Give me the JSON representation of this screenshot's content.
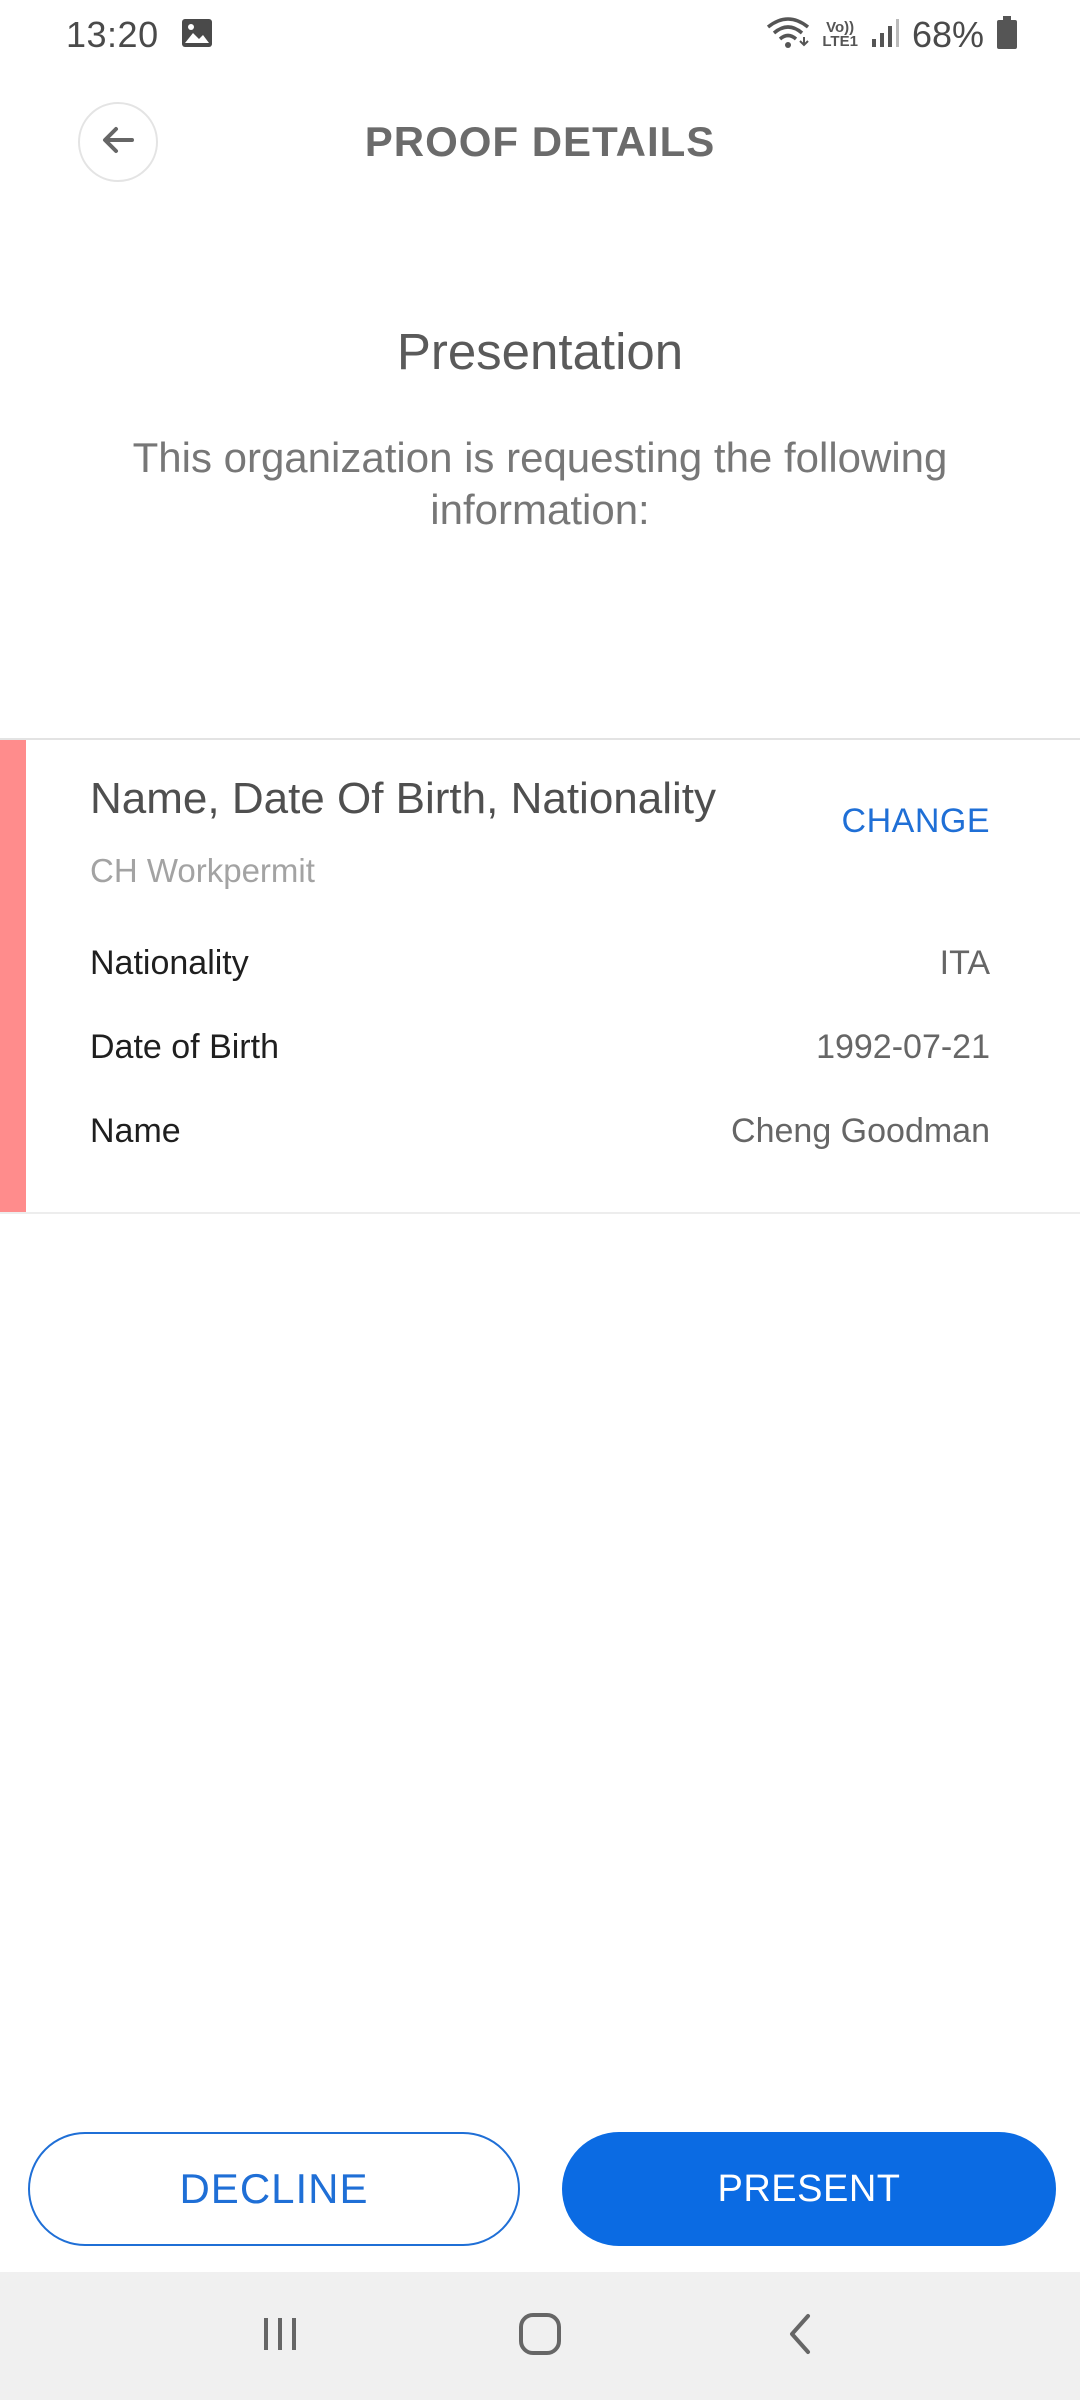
{
  "status_bar": {
    "time": "13:20",
    "network": "LTE1",
    "volte": "Vo))",
    "battery": "68%",
    "icons": [
      "gallery-icon",
      "wifi-icon",
      "signal-icon",
      "battery-icon"
    ]
  },
  "header": {
    "title": "PROOF DETAILS",
    "back_icon": "arrow-left-icon"
  },
  "intro": {
    "title": "Presentation",
    "description": "This organization is requesting the following information:"
  },
  "card": {
    "title": "Name, Date Of Birth, Nationality",
    "subtitle": "CH Workpermit",
    "change_label": "CHANGE",
    "attributes": [
      {
        "label": "Nationality",
        "value": "ITA"
      },
      {
        "label": "Date of Birth",
        "value": "1992-07-21"
      },
      {
        "label": "Name",
        "value": "Cheng Goodman"
      }
    ]
  },
  "actions": {
    "decline_label": "DECLINE",
    "present_label": "PRESENT"
  },
  "nav_bar": {
    "icons": [
      "recent-apps-icon",
      "home-icon",
      "back-icon"
    ]
  },
  "colors": {
    "accent": "#0b6be3",
    "card_accent": "#ff8c8c",
    "link": "#1f6fd6"
  }
}
